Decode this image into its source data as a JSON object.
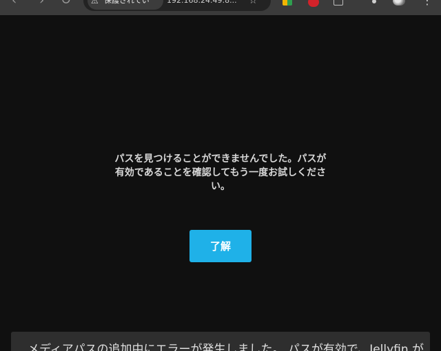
{
  "browser": {
    "nav": {
      "back": "‹",
      "forward": "›",
      "reload": "↻"
    },
    "security_label": "保護されてい",
    "url": "192.168.24.49:8...",
    "star": "☆",
    "menu": "⋮",
    "icons": [
      "warning-icon",
      "extension-icon",
      "notification-icon",
      "share-icon",
      "avatar",
      "menu-icon"
    ]
  },
  "dialog": {
    "message": "パスを見つけることができませんでした。パスが有効であることを確認してもう一度お試しください。",
    "ok_label": "了解",
    "accent_color": "#1fb1e8"
  },
  "background_panel": {
    "text": "メディアパスの追加中にエラーが発生しました。 パスが有効で、Jellyfin が"
  }
}
